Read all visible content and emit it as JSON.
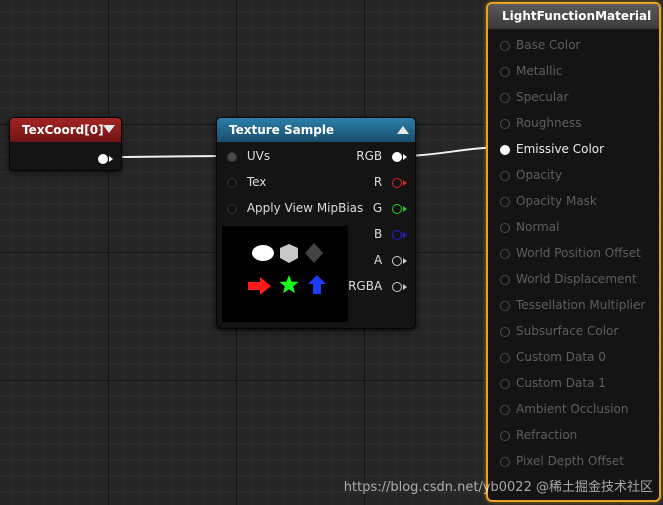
{
  "colors": {
    "texcoord_header": "#8d1c1c",
    "texture_header": "#1d5d82",
    "material_border": "#e8a321",
    "pin_r": "#e02020",
    "pin_g": "#20d020",
    "pin_b": "#2020e0",
    "wire": "#f0f0f0"
  },
  "texcoord_node": {
    "title": "TexCoord[0]"
  },
  "texture_node": {
    "title": "Texture Sample",
    "inputs": [
      {
        "label": "UVs",
        "pin_icon": "circle-pin-icon"
      },
      {
        "label": "Tex",
        "pin_icon": "circle-pin-icon"
      },
      {
        "label": "Apply View MipBias",
        "pin_icon": "circle-pin-icon"
      }
    ],
    "outputs": [
      {
        "label": "RGB",
        "pin_icon": "circle-pin-icon"
      },
      {
        "label": "R",
        "pin_icon": "circle-pin-icon"
      },
      {
        "label": "G",
        "pin_icon": "circle-pin-icon"
      },
      {
        "label": "B",
        "pin_icon": "circle-pin-icon"
      },
      {
        "label": "A",
        "pin_icon": "circle-pin-icon"
      },
      {
        "label": "RGBA",
        "pin_icon": "circle-pin-icon"
      }
    ],
    "preview_icons": [
      "ellipse-shape-icon",
      "hexagon-shape-icon",
      "diamond-shape-icon",
      "red-arrow-icon",
      "green-star-icon",
      "blue-up-arrow-icon"
    ]
  },
  "material_node": {
    "title": "LightFunctionMaterial",
    "inputs": [
      {
        "label": "Base Color",
        "active": false
      },
      {
        "label": "Metallic",
        "active": false
      },
      {
        "label": "Specular",
        "active": false
      },
      {
        "label": "Roughness",
        "active": false
      },
      {
        "label": "Emissive Color",
        "active": true
      },
      {
        "label": "Opacity",
        "active": false
      },
      {
        "label": "Opacity Mask",
        "active": false
      },
      {
        "label": "Normal",
        "active": false
      },
      {
        "label": "World Position Offset",
        "active": false
      },
      {
        "label": "World Displacement",
        "active": false
      },
      {
        "label": "Tessellation Multiplier",
        "active": false
      },
      {
        "label": "Subsurface Color",
        "active": false
      },
      {
        "label": "Custom Data 0",
        "active": false
      },
      {
        "label": "Custom Data 1",
        "active": false
      },
      {
        "label": "Ambient Occlusion",
        "active": false
      },
      {
        "label": "Refraction",
        "active": false
      },
      {
        "label": "Pixel Depth Offset",
        "active": false
      }
    ]
  },
  "watermark": "https://blog.csdn.net/yb0022 @稀土掘金技术社区"
}
